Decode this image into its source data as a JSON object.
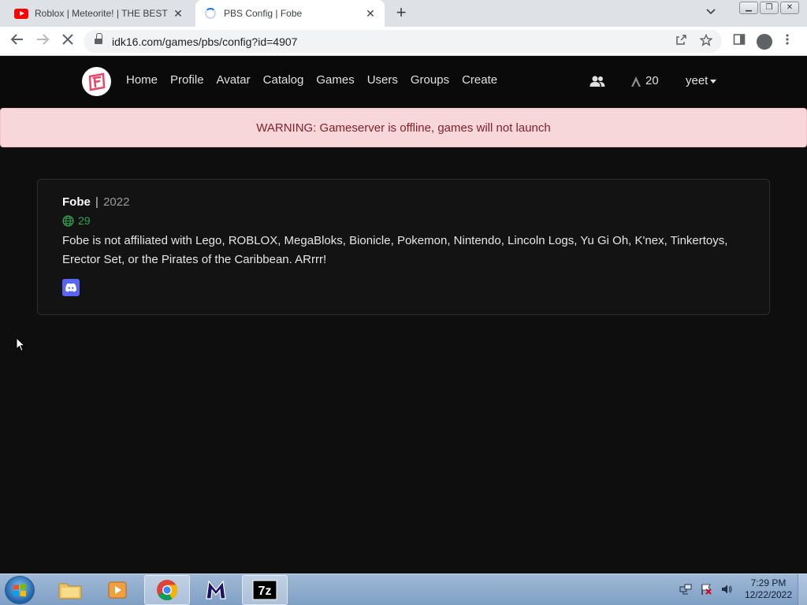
{
  "browser": {
    "tabs": [
      {
        "title": "Roblox | Meteorite! | THE BEST R",
        "active": false
      },
      {
        "title": "PBS Config | Fobe",
        "active": true
      }
    ],
    "new_tab": "+",
    "close": "✕",
    "url": "idk16.com/games/pbs/config?id=4907"
  },
  "site": {
    "nav": [
      "Home",
      "Profile",
      "Avatar",
      "Catalog",
      "Games",
      "Users",
      "Groups",
      "Create"
    ],
    "currency": "20",
    "username": "yeet"
  },
  "alert": {
    "text": "WARNING: Gameserver is offline, games will not launch"
  },
  "card": {
    "name": "Fobe",
    "separator": "|",
    "year": "2022",
    "online_count": "29",
    "description": "Fobe is not affiliated with Lego, ROBLOX, MegaBloks, Bionicle, Pokemon, Nintendo, Lincoln Logs, Yu Gi Oh, K'nex, Tinkertoys, Erector Set, or the Pirates of the Caribbean. ARrrr!"
  },
  "taskbar": {
    "time": "7:29 PM",
    "date": "12/22/2022"
  },
  "colors": {
    "alert_bg": "#f8d7da",
    "alert_text": "#842029",
    "online_green": "#2ea44f",
    "discord": "#5865f2",
    "page_bg": "#0f0e0f"
  }
}
